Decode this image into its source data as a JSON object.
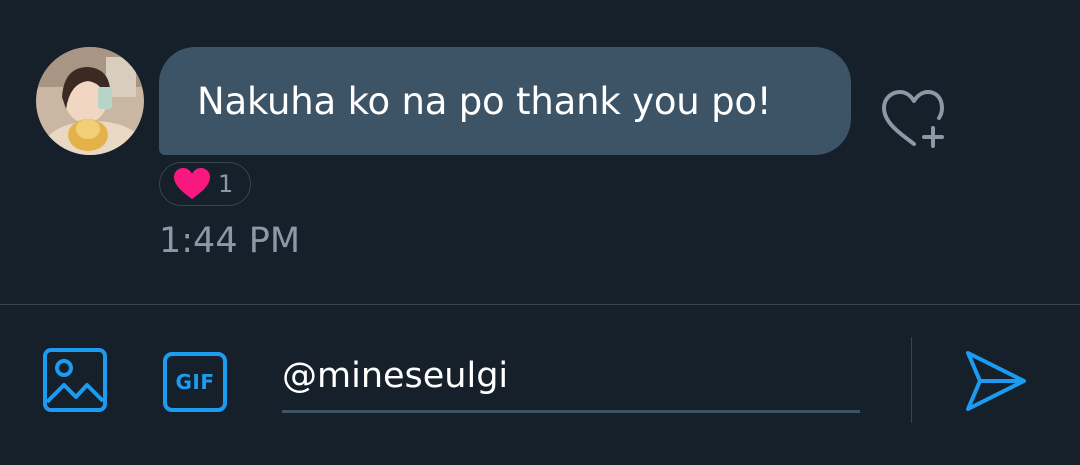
{
  "thread": {
    "message": {
      "text": "Nakuha ko na po thank you po!",
      "reaction": {
        "emoji": "heart-icon",
        "count": "1"
      },
      "timestamp": "1:44 PM"
    }
  },
  "composer": {
    "gif_label": "GIF",
    "input_value": "@mineseulgi"
  },
  "colors": {
    "background": "#15202b",
    "bubble": "#3d5466",
    "accent": "#1d9bf0",
    "muted_text": "#8b98a5",
    "reaction_heart": "#f91880"
  }
}
